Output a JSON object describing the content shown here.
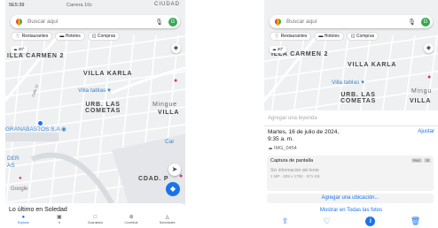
{
  "left": {
    "status_time": "5E5:39",
    "status_road": "Carrera 10c",
    "status_city": "CIUDAD",
    "search_placeholder": "Buscar aquí",
    "avatar_initial": "G",
    "chips": [
      "Restaurantes",
      "Hoteles",
      "Compras"
    ],
    "weather": "20°",
    "map_labels": {
      "carmen": "ILLA CARMEN 2",
      "karla": "VILLA KARLA",
      "tablas": "Villa tablas",
      "urb_line1": "URB. LAS",
      "urb_line2": "COMETAS",
      "mingueo": "Mingue",
      "villa_right": "VILLA",
      "granabastos": "GRANABASTOS S.A",
      "der_line1": "DER",
      "der_line2": "AS",
      "car": "Car",
      "cdad": "CDAD. P",
      "calle": "Calle 10"
    },
    "google_logo": "Google",
    "sheet_title": "Lo último en Soledad",
    "tabs": [
      {
        "icon": "●",
        "label": "Explorar",
        "active": true
      },
      {
        "icon": "▣",
        "label": "Ir",
        "active": false
      },
      {
        "icon": "□",
        "label": "Guardados",
        "active": false
      },
      {
        "icon": "⊕",
        "label": "Contribuir",
        "active": false
      },
      {
        "icon": "◬",
        "label": "Novedades",
        "active": false
      }
    ]
  },
  "right": {
    "search_placeholder": "Buscar aquí",
    "avatar_initial": "G",
    "chips": [
      "Restaurantes",
      "Hoteles",
      "Compras"
    ],
    "weather": "20°",
    "map_labels": {
      "carmen": "ILLA CARMEN 2",
      "karla": "VILLA KARLA",
      "tablas": "Villa tablas",
      "urb_line1": "URB. LAS",
      "urb_line2": "COMETAS",
      "mingueo": "Mingu",
      "villa_right": "VILLA"
    },
    "caption_placeholder": "Agregar una leyenda",
    "date_line1": "Martes, 16 de julio de 2024,",
    "date_line2": "9:35 a. m.",
    "adjust_label": "Ajustar",
    "image_name": "IMG_0454",
    "source_title": "Captura de pantalla",
    "badge1": "PNG",
    "badge2": "",
    "no_info": "Sin información del lente",
    "specs": "1 MP · 828 x 1792 · 571 KB",
    "add_location": "Agregar una ubicación...",
    "show_all": "Mostrar en Todas las fotos"
  }
}
